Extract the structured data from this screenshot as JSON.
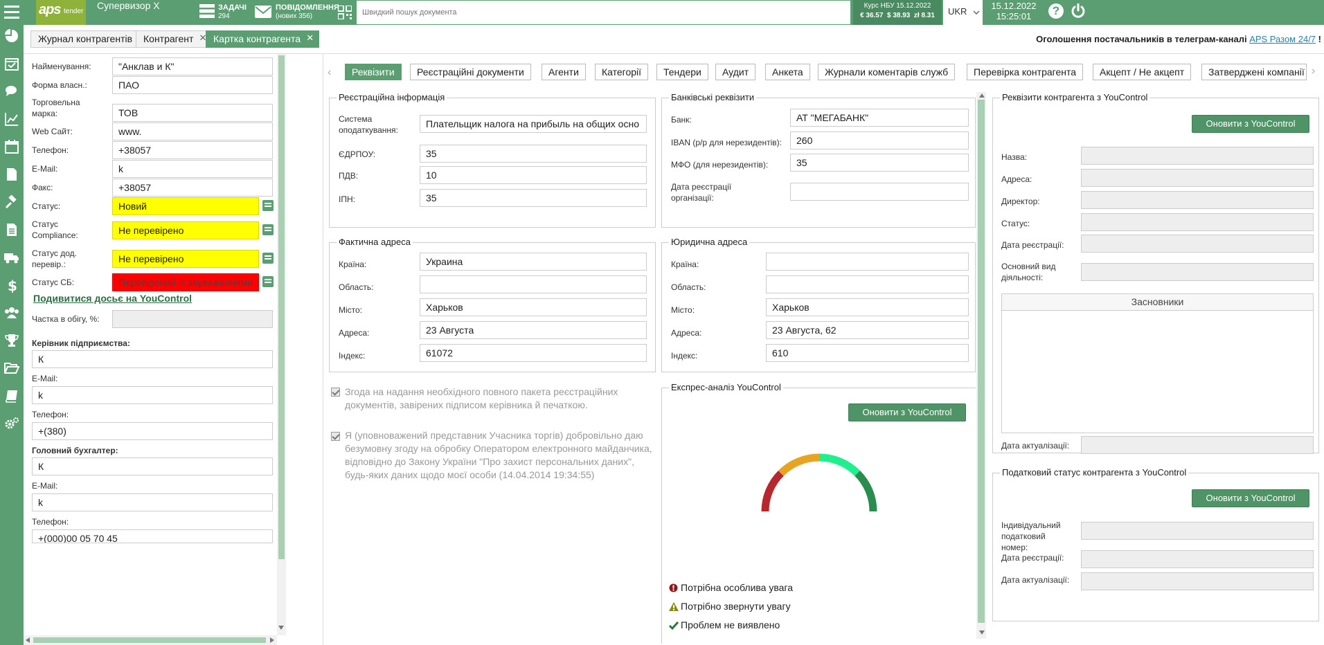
{
  "topbar": {
    "logo_text": "aps",
    "logo_sub": "tender",
    "user": "Супервизор X",
    "tasks_label": "ЗАДАЧІ",
    "tasks_count": "294",
    "messages_label": "ПОВІДОМЛЕННЯ",
    "messages_count": "(нових 356)",
    "search_placeholder": "Швидкий пошук документа",
    "rate_title": "Курс НБУ 15.12.2022",
    "rate_values": "€ 36.57  $ 38.93  zł 8.31",
    "lang": "UKR",
    "date": "15.12.2022",
    "time": "15:25:01",
    "help": "?",
    "power_icon": "power-icon"
  },
  "page_tabs": [
    {
      "label": "Журнал контрагентів"
    },
    {
      "label": "Контрагент"
    },
    {
      "label": "Картка контрагента"
    }
  ],
  "announcement": {
    "text": "Оголошення постачальників в телеграм-каналі",
    "link": "APS Разом 24/7",
    "mark": "!"
  },
  "left_form": {
    "name_label": "Найменування:",
    "name_value": "\"Анклав и К\"",
    "ownership_label": "Форма власн.:",
    "ownership_value": "ПАО",
    "trademark_label": "Торговельна марка:",
    "trademark_value": "ТОВ",
    "website_label": "Web Сайт:",
    "website_value": "www.",
    "phone_label": "Телефон:",
    "phone_value": "+38057",
    "email_label": "E-Mail:",
    "email_value": "k",
    "fax_label": "Факс:",
    "fax_value": "+38057",
    "status_label": "Статус:",
    "status_value": "Новий",
    "compliance_label": "Статус Compliance:",
    "compliance_value": "Не перевірено",
    "addcheck_label": "Статус дод. перевір.:",
    "addcheck_value": "Не перевірено",
    "sb_label": "Статус СБ:",
    "sb_value": "Перевірений із зауваженнями",
    "dossier_link": "Подивитися досьє на YouControl",
    "share_label": "Частка в обігу, %:",
    "share_value": "",
    "director_heading": "Керівник підприємства:",
    "director_value": "К",
    "director_email_label": "E-Mail:",
    "director_email_value": "k",
    "director_phone_label": "Телефон:",
    "director_phone_value": "+(380)",
    "accountant_heading": "Головний бухгалтер:",
    "accountant_value": "К",
    "accountant_email_label": "E-Mail:",
    "accountant_email_value": "k",
    "accountant_phone_label": "Телефон:",
    "accountant_phone_value": "+(000)00 05 70 45"
  },
  "sub_tabs": [
    {
      "label": "Реквізити"
    },
    {
      "label": "Реєстраційні документи"
    },
    {
      "label": "Агенти"
    },
    {
      "label": "Категорії"
    },
    {
      "label": "Тендери"
    },
    {
      "label": "Аудит"
    },
    {
      "label": "Анкета"
    },
    {
      "label": "Журнали коментарів служб"
    },
    {
      "label": "Перевірка контрагента"
    },
    {
      "label": "Акцепт / Не акцепт"
    },
    {
      "label": "Затверджені компанії"
    }
  ],
  "registration": {
    "title": "Реєстраційна інформація",
    "tax_label": "Система оподаткування:",
    "tax_value": "Плательщик налога на прибыль на общих осно",
    "edrpou_label": "ЄДРПОУ:",
    "edrpou_value": "35",
    "vat_label": "ПДВ:",
    "vat_value": "10",
    "ipn_label": "ІПН:",
    "ipn_value": "35"
  },
  "bank": {
    "title": "Банківські реквізити",
    "bank_label": "Банк:",
    "bank_value": "АТ \"МЕГАБАНК\"",
    "iban_label": "IBAN (р/р для нерезидентів):",
    "iban_value": "260",
    "mfo_label": "МФО (для нерезидентів):",
    "mfo_value": "35",
    "regdate_label": "Дата реєстрації організації:",
    "regdate_value": ""
  },
  "actual_address": {
    "title": "Фактична адреса",
    "country_label": "Країна:",
    "country_value": "Украина",
    "region_label": "Область:",
    "region_value": "",
    "city_label": "Місто:",
    "city_value": "Харьков",
    "address_label": "Адреса:",
    "address_value": "23 Августа",
    "index_label": "Індекс:",
    "index_value": "61072"
  },
  "legal_address": {
    "title": "Юридична адреса",
    "country_label": "Країна:",
    "country_value": "",
    "region_label": "Область:",
    "region_value": "",
    "city_label": "Місто:",
    "city_value": "Харьков",
    "address_label": "Адреса:",
    "address_value": "23 Августа, 62",
    "index_label": "Індекс:",
    "index_value": "610"
  },
  "consents": {
    "consent1": "Згода на надання необхідного повного пакета реєстраційних документів, завірених підписом керівника й печаткою.",
    "consent2": "Я (уповноважений представник Учасника торгів) добровільно даю безумовну згоду на обробку Оператором електронного майданчика, відповідно до Закону України \"Про захист персональних даних\", будь-яких даних щодо моєї особи (14.04.2014 19:34:55)"
  },
  "express": {
    "title": "Експрес-аналіз YouControl",
    "button": "Оновити з YouControl",
    "legend_attention": "Потрібна особлива увага",
    "legend_notice": "Потрібно звернути увагу",
    "legend_ok": "Проблем не виявлено",
    "colors": {
      "red": "#b8272d",
      "orange": "#e8a321",
      "cyan": "#1ef08d",
      "green": "#2a8c4f"
    }
  },
  "yc_requisites": {
    "title": "Реквізити контрагента з YouControl",
    "button": "Оновити з YouControl",
    "name_label": "Назва:",
    "address_label": "Адреса:",
    "director_label": "Директор:",
    "status_label": "Статус:",
    "regdate_label": "Дата реєстрації:",
    "activity_label": "Основний вид діяльності:",
    "founders_header": "Засновники",
    "update_label": "Дата актуалізації:"
  },
  "yc_tax": {
    "title": "Податковий статус контрагента з YouControl",
    "button": "Оновити з YouControl",
    "ipn_label": "Індивідуальний податковий номер:",
    "regdate_label": "Дата реєстрації:",
    "update_label": "Дата актуалізації:"
  },
  "colors": {
    "brand": "#5a9e72",
    "status_yellow": "#ffff00",
    "status_red": "#ff0000"
  }
}
